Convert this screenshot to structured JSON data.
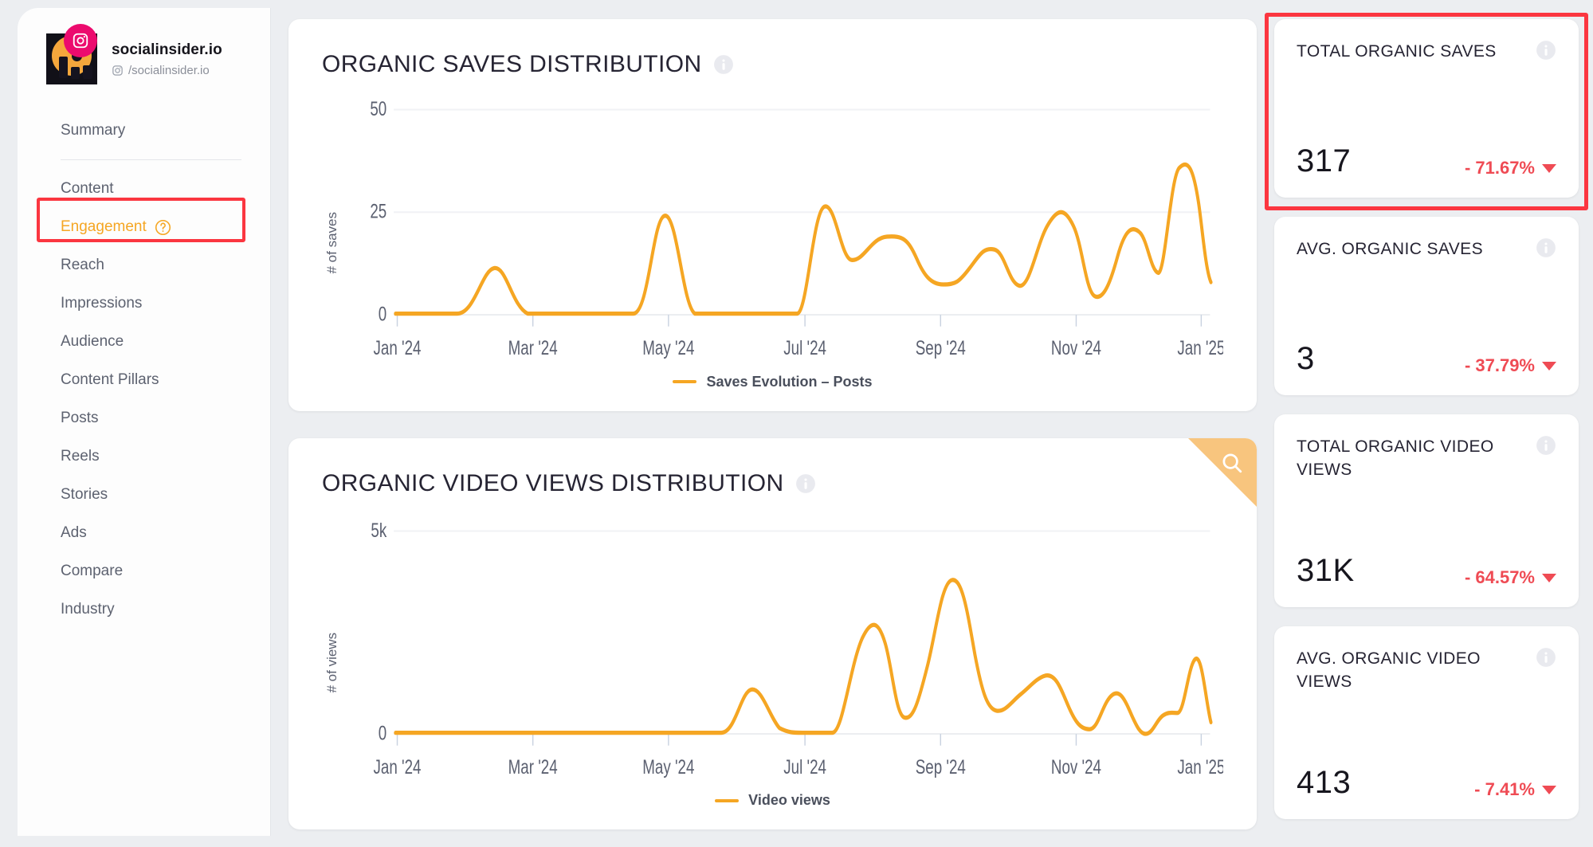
{
  "sidebar": {
    "brand": {
      "name": "socialinsider.io",
      "handle": "/socialinsider.io",
      "platform_icon": "instagram-icon",
      "badge_color": "#ec0b6e"
    },
    "items": [
      {
        "label": "Summary",
        "active": false
      },
      {
        "label": "Content",
        "active": false
      },
      {
        "label": "Engagement",
        "active": true,
        "help_icon": "question-circle-icon"
      },
      {
        "label": "Reach",
        "active": false
      },
      {
        "label": "Impressions",
        "active": false
      },
      {
        "label": "Audience",
        "active": false
      },
      {
        "label": "Content Pillars",
        "active": false
      },
      {
        "label": "Posts",
        "active": false
      },
      {
        "label": "Reels",
        "active": false
      },
      {
        "label": "Stories",
        "active": false
      },
      {
        "label": "Ads",
        "active": false
      },
      {
        "label": "Compare",
        "active": false
      },
      {
        "label": "Industry",
        "active": false
      }
    ],
    "active_color": "#f5a623",
    "highlight_color": "#fb3640"
  },
  "charts": [
    {
      "title": "ORGANIC SAVES DISTRIBUTION",
      "info_icon": "info-icon",
      "legend": "Saves Evolution – Posts",
      "legend_color": "#f5a623",
      "has_corner_badge": false
    },
    {
      "title": "ORGANIC VIDEO VIEWS DISTRIBUTION",
      "info_icon": "info-icon",
      "legend": "Video views",
      "legend_color": "#f5a623",
      "has_corner_badge": true,
      "corner_icon": "search-icon"
    }
  ],
  "kpis": [
    {
      "label": "TOTAL ORGANIC SAVES",
      "value": "317",
      "change": "- 71.67%",
      "direction": "down",
      "info_icon": "info-icon",
      "highlighted": true
    },
    {
      "label": "AVG. ORGANIC SAVES",
      "value": "3",
      "change": "- 37.79%",
      "direction": "down",
      "info_icon": "info-icon",
      "highlighted": false
    },
    {
      "label": "TOTAL ORGANIC VIDEO VIEWS",
      "value": "31K",
      "change": "- 64.57%",
      "direction": "down",
      "info_icon": "info-icon",
      "highlighted": false
    },
    {
      "label": "AVG. ORGANIC VIDEO VIEWS",
      "value": "413",
      "change": "- 7.41%",
      "direction": "down",
      "info_icon": "info-icon",
      "highlighted": false
    }
  ],
  "chart_data": [
    {
      "type": "line",
      "title": "ORGANIC SAVES DISTRIBUTION",
      "xlabel": "",
      "ylabel": "# of saves",
      "ylim": [
        0,
        50
      ],
      "yticks": [
        0,
        25,
        50
      ],
      "ytick_labels": [
        "0",
        "25",
        "50"
      ],
      "xtick_labels": [
        "Jan '24",
        "Mar '24",
        "May '24",
        "Jul '24",
        "Sep '24",
        "Nov '24",
        "Jan '25"
      ],
      "grid": true,
      "legend": [
        "Saves Evolution – Posts"
      ],
      "legend_position": "bottom-center",
      "color": "#f5a623",
      "series": [
        {
          "name": "Saves Evolution – Posts",
          "x": [
            "Jan '24",
            "Jan '24",
            "Feb '24",
            "Feb '24",
            "Feb '24",
            "Mar '24",
            "Mar '24",
            "Apr '24",
            "Apr '24",
            "May '24",
            "May '24",
            "Jun '24",
            "Jun '24",
            "Jun '24",
            "Jul '24",
            "Jul '24",
            "Aug '24",
            "Aug '24",
            "Aug '24",
            "Sep '24",
            "Sep '24",
            "Sep '24",
            "Oct '24",
            "Oct '24",
            "Oct '24",
            "Nov '24",
            "Nov '24",
            "Nov '24",
            "Dec '24",
            "Dec '24",
            "Dec '24",
            "Jan '25",
            "Jan '25"
          ],
          "values": [
            0,
            0,
            0,
            11,
            3,
            0,
            0,
            0,
            0,
            0,
            24,
            2,
            0,
            0,
            0,
            0,
            27,
            13,
            18,
            18,
            7,
            7,
            13,
            8,
            22,
            5,
            16,
            7,
            36,
            9,
            9,
            4,
            1
          ]
        }
      ]
    },
    {
      "type": "line",
      "title": "ORGANIC VIDEO VIEWS DISTRIBUTION",
      "xlabel": "",
      "ylabel": "# of views",
      "ylim": [
        0,
        5000
      ],
      "yticks": [
        0,
        5000
      ],
      "ytick_labels": [
        "0",
        "5k"
      ],
      "xtick_labels": [
        "Jan '24",
        "Mar '24",
        "May '24",
        "Jul '24",
        "Sep '24",
        "Nov '24",
        "Jan '25"
      ],
      "grid": true,
      "legend": [
        "Video views"
      ],
      "legend_position": "bottom-center",
      "color": "#f5a623",
      "series": [
        {
          "name": "Video views",
          "x": [
            "Jan '24",
            "Feb '24",
            "Mar '24",
            "Apr '24",
            "May '24",
            "Jun '24",
            "Jun '24",
            "Jul '24",
            "Jul '24",
            "Aug '24",
            "Aug '24",
            "Aug '24",
            "Sep '24",
            "Sep '24",
            "Sep '24",
            "Oct '24",
            "Oct '24",
            "Oct '24",
            "Nov '24",
            "Nov '24",
            "Nov '24",
            "Dec '24",
            "Dec '24",
            "Dec '24",
            "Jan '25",
            "Jan '25"
          ],
          "values": [
            0,
            0,
            0,
            0,
            0,
            0,
            950,
            120,
            0,
            0,
            3050,
            850,
            4250,
            1150,
            1350,
            2000,
            700,
            1450,
            100,
            800,
            2400,
            2350,
            900,
            2150,
            200,
            300
          ]
        }
      ]
    }
  ]
}
